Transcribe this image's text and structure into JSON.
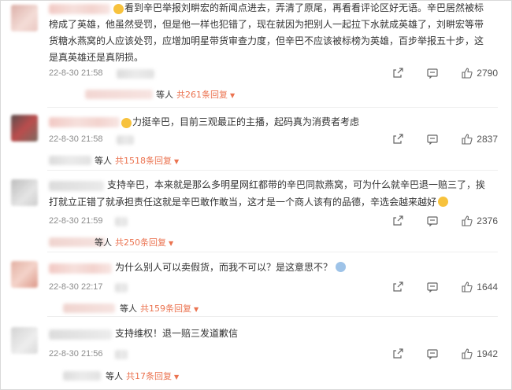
{
  "colors": {
    "accent": "#eb7350",
    "time": "#8c8c8c"
  },
  "comments": [
    {
      "prefix": "",
      "lines": [
        "看到辛巴举报刘畊宏的新闻点进去，弄清了原尾，再看看评论区好无语。辛巴居然被标",
        "榜成了英雄，他虽然受罚，但是他一样也犯错了，现在就因为把别人一起拉下水就成英雄了，刘畊宏等带",
        "货糖水燕窝的人应该处罚，应增加明星带货审查力度，但辛巴不应该被标榜为英雄，百步举报五十步，这",
        "是真英雄还是真阴损。"
      ],
      "time": "22-8-30 21:58",
      "likes": "2790",
      "replies_people": "等人",
      "replies_count": "共261条回复"
    },
    {
      "prefix": "",
      "lines": [
        "力挺辛巴，目前三观最正的主播，起码真为消费者考虑"
      ],
      "time": "22-8-30 21:58",
      "likes": "2837",
      "replies_people": "等人",
      "replies_count": "共1518条回复"
    },
    {
      "prefix": "",
      "lines": [
        "支持辛巴，本来就是那么多明星网红都带的辛巴同款燕窝，可为什么就辛巴退一赔三了，挨",
        "打就立正错了就承担责任这就是辛巴敢作敢当，这才是一个商人该有的品德，辛选会越来越好"
      ],
      "time": "22-8-30 21:59",
      "likes": "2376",
      "replies_people": "等人",
      "replies_count": "共250条回复"
    },
    {
      "prefix": "",
      "lines": [
        "为什么别人可以卖假货，而我不可以？是这意思不？"
      ],
      "time": "22-8-30 22:17",
      "likes": "1644",
      "replies_people": "等人",
      "replies_count": "共159条回复"
    },
    {
      "prefix": "",
      "lines": [
        "支持维权！退一赔三发道歉信"
      ],
      "time": "22-8-30 21:56",
      "likes": "1942",
      "replies_people": "等人",
      "replies_count": "共17条回复"
    }
  ]
}
